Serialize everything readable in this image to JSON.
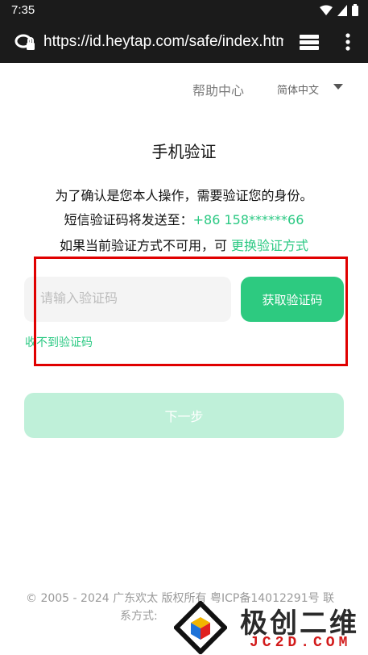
{
  "status_bar": {
    "time": "7:35"
  },
  "browser": {
    "url": "https://id.heytap.com/safe/index.html"
  },
  "header": {
    "help_label": "帮助中心",
    "language_label": "简体中文"
  },
  "main": {
    "title": "手机验证",
    "line1": "为了确认是您本人操作，需要验证您的身份。",
    "line2_prefix": "短信验证码将发送至：",
    "phone": "+86 158******66",
    "line3_prefix": "如果当前验证方式不可用，可 ",
    "switch_method_link": "更换验证方式",
    "code_placeholder": "请输入验证码",
    "code_value": "",
    "get_code_label": "获取验证码",
    "no_code_link": "收不到验证码",
    "next_label": "下一步"
  },
  "footer": {
    "line1": "© 2005 - 2024 广东欢太 版权所有 粤ICP备14012291号 联",
    "line2": "系方式:"
  },
  "watermark": {
    "title": "极创二维",
    "subtitle": "JC2D.COM"
  },
  "colors": {
    "accent": "#2dca80",
    "accent_disabled": "#bff0d9",
    "highlight": "#e00000",
    "bar_bg": "#1b1b1b"
  }
}
